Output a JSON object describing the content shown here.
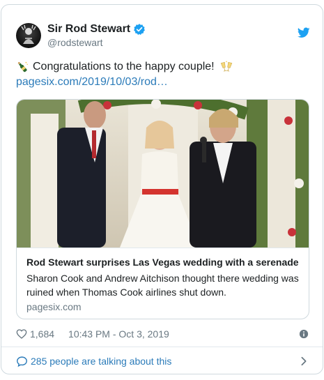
{
  "tweet": {
    "display_name": "Sir Rod Stewart",
    "handle": "@rodstewart",
    "text": "Congratulations to the happy couple!",
    "link": "pagesix.com/2019/10/03/rod…",
    "likes": "1,684",
    "timestamp": "10:43 PM - Oct 3, 2019",
    "talking": "285 people are talking about this"
  },
  "card": {
    "title": "Rod Stewart surprises Las Vegas wedding with a serenade",
    "description": "Sharon Cook and Andrew Aitchison thought there wedding was ruined when Thomas Cook airlines shut down.",
    "domain": "pagesix.com"
  },
  "icons": {
    "verified": "verified-badge-icon",
    "brand": "twitter-bird-icon",
    "emoji_start": "bottle-with-popping-cork-emoji",
    "emoji_end": "clinking-glasses-emoji",
    "like": "heart-icon",
    "info": "info-icon",
    "reply": "speech-bubble-icon",
    "more": "chevron-right-icon"
  },
  "colors": {
    "link": "#2b7bb9",
    "brand": "#1da1f2",
    "secondary_text": "#697882",
    "border": "#cfd9de"
  }
}
